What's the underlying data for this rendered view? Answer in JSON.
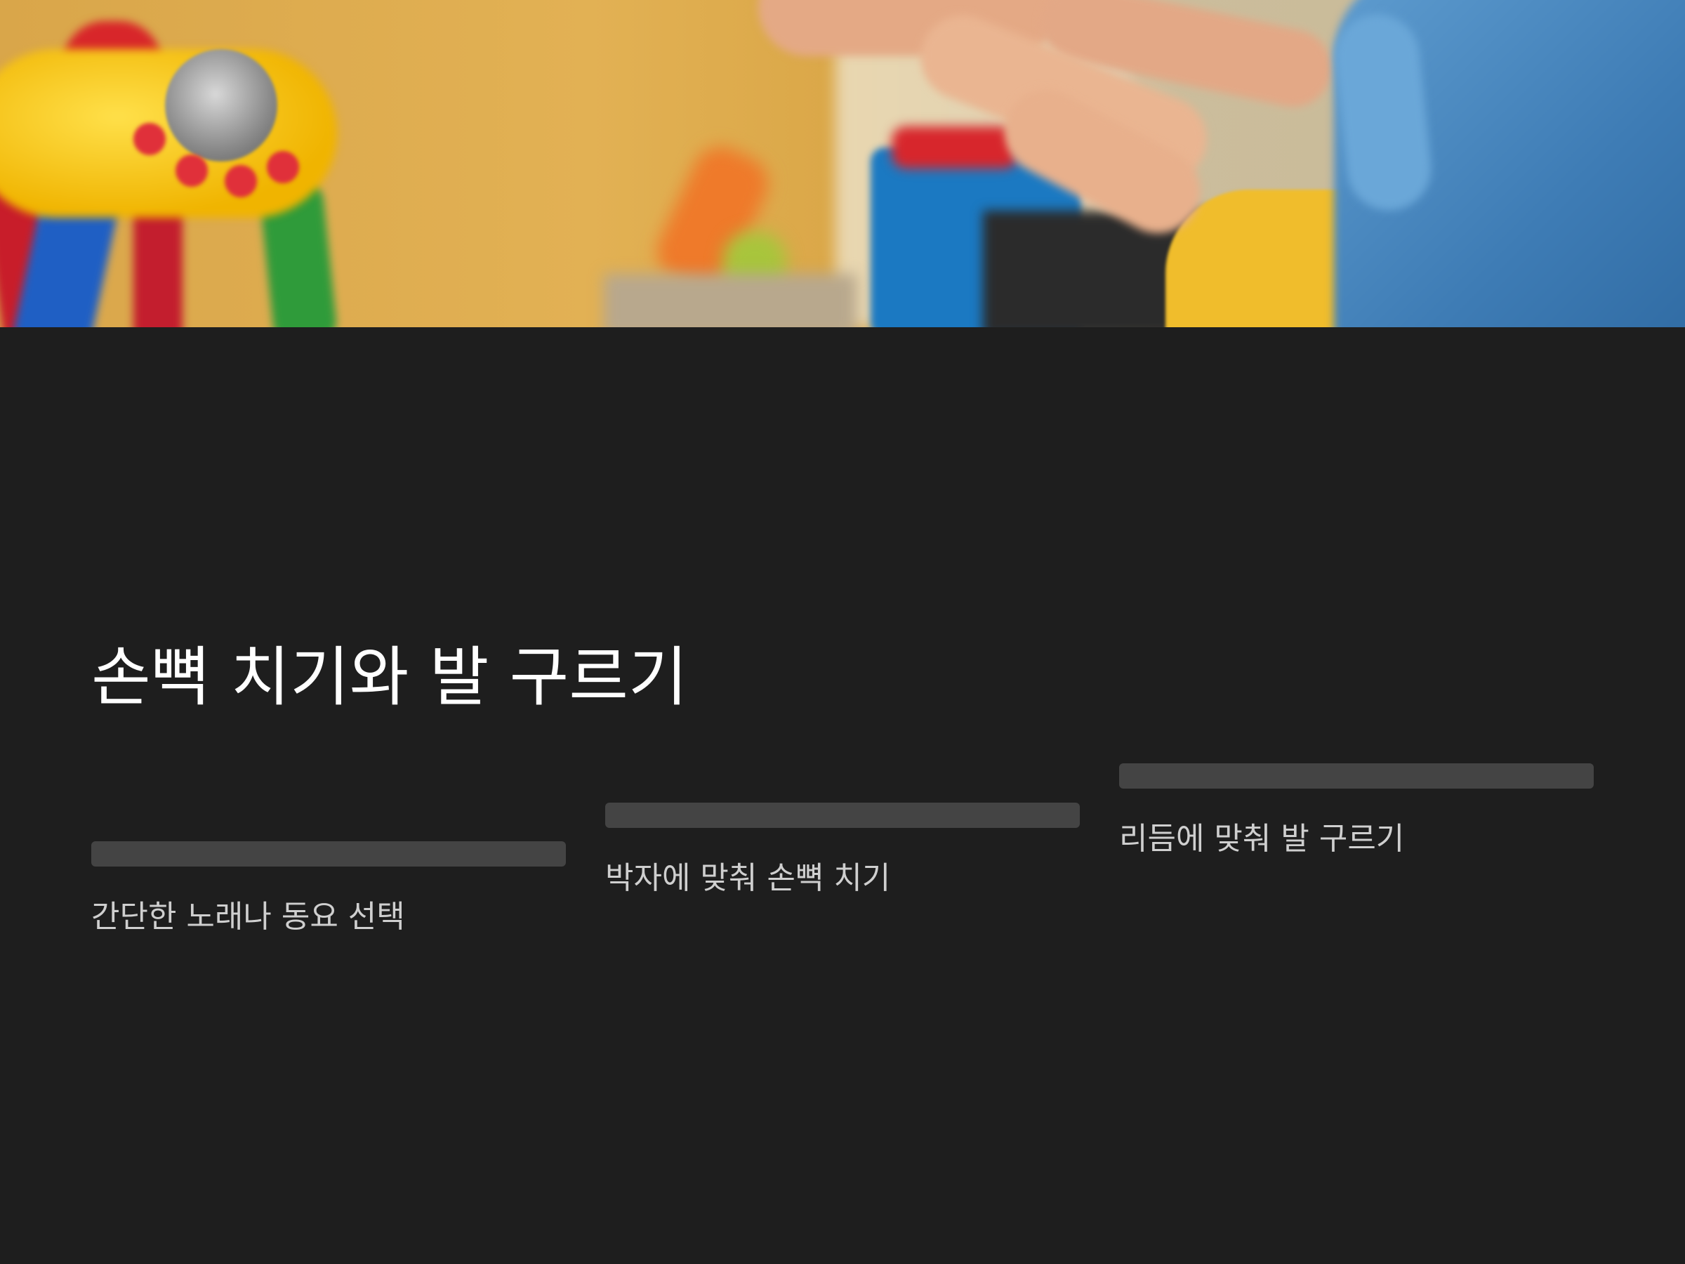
{
  "slide": {
    "title": "손뼉 치기와 발 구르기",
    "hero_image": {
      "description_icon": "children-clapping-photo"
    },
    "steps": [
      {
        "label": "간단한 노래나 동요 선택"
      },
      {
        "label": "박자에 맞춰 손뼉 치기"
      },
      {
        "label": "리듬에 맞춰 발 구르기"
      }
    ]
  },
  "colors": {
    "background": "#1e1e1e",
    "title": "#ffffff",
    "step_text": "#cfcfcf",
    "step_bar": "#444444"
  }
}
